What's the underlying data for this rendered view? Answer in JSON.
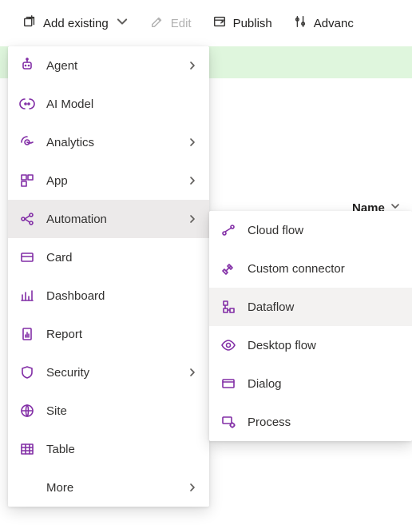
{
  "toolbar": {
    "add_existing": "Add existing",
    "edit": "Edit",
    "publish": "Publish",
    "advanced": "Advanc"
  },
  "columns": {
    "name": "Name"
  },
  "menu": {
    "items": [
      {
        "label": "Agent"
      },
      {
        "label": "AI Model"
      },
      {
        "label": "Analytics"
      },
      {
        "label": "App"
      },
      {
        "label": "Automation"
      },
      {
        "label": "Card"
      },
      {
        "label": "Dashboard"
      },
      {
        "label": "Report"
      },
      {
        "label": "Security"
      },
      {
        "label": "Site"
      },
      {
        "label": "Table"
      },
      {
        "label": "More"
      }
    ]
  },
  "submenu": {
    "items": [
      {
        "label": "Cloud flow"
      },
      {
        "label": "Custom connector"
      },
      {
        "label": "Dataflow"
      },
      {
        "label": "Desktop flow"
      },
      {
        "label": "Dialog"
      },
      {
        "label": "Process"
      }
    ]
  }
}
